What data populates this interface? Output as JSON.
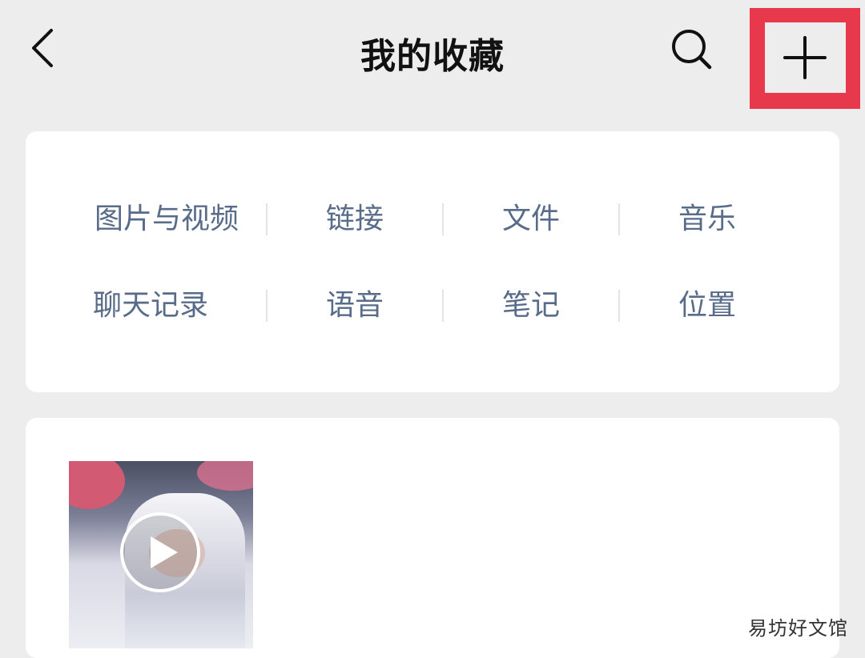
{
  "header": {
    "title": "我的收藏",
    "back_icon": "chevron-left-icon",
    "search_icon": "search-icon",
    "add_icon": "plus-icon",
    "highlight_color": "#e8384b"
  },
  "categories": [
    {
      "label": "图片与视频"
    },
    {
      "label": "链接"
    },
    {
      "label": "文件"
    },
    {
      "label": "音乐"
    },
    {
      "label": "聊天记录"
    },
    {
      "label": "语音"
    },
    {
      "label": "笔记"
    },
    {
      "label": "位置"
    }
  ],
  "favorites": [
    {
      "type": "video",
      "play_icon": "play-icon"
    }
  ],
  "watermark": "易坊好文馆"
}
